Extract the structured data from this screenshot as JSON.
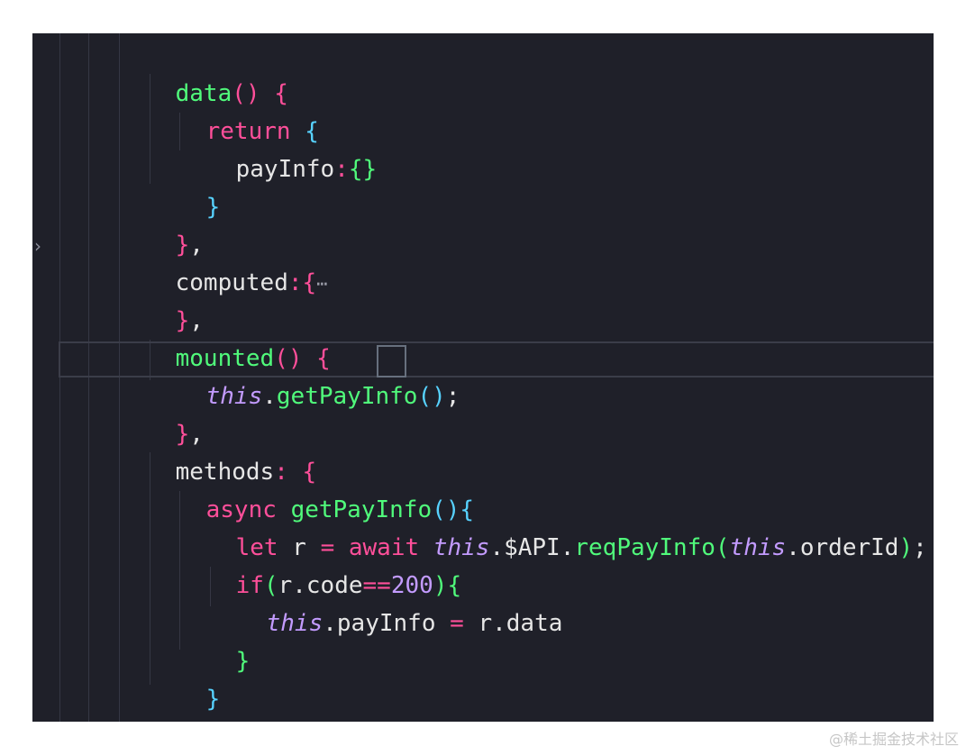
{
  "editor": {
    "fold_marker": "›",
    "collapsed_ellipsis": "⋯",
    "lines": [
      [
        "data",
        "()",
        " {"
      ],
      [
        "return",
        " {"
      ],
      [
        "payInfo",
        ":",
        "{}"
      ],
      [
        "}"
      ],
      [
        "}",
        ","
      ],
      [
        "computed",
        ":",
        "{"
      ],
      [
        "}",
        ","
      ],
      [
        "mounted",
        "()",
        " {"
      ],
      [
        "this",
        ".",
        "getPayInfo",
        "(",
        ")",
        ";"
      ],
      [
        "}",
        ","
      ],
      [
        "methods",
        ":",
        " {"
      ],
      [
        "async",
        " ",
        "getPayInfo",
        "()",
        "{"
      ],
      [
        "let",
        " ",
        "r",
        " ",
        "=",
        " ",
        "await",
        " ",
        "this",
        ".",
        "$API",
        ".",
        "reqPayInfo",
        "(",
        "this",
        ".",
        "orderId",
        ")",
        ";"
      ],
      [
        "if",
        "(",
        "r",
        ".",
        "code",
        "==",
        "200",
        ")",
        "{"
      ],
      [
        "this",
        ".",
        "payInfo",
        " ",
        "=",
        " ",
        "r",
        ".",
        "data"
      ],
      [
        "}"
      ],
      [
        "}"
      ],
      [
        "}",
        ","
      ]
    ]
  },
  "watermark": "@稀土掘金技术社区",
  "colors": {
    "background": "#1f2029",
    "function": "#50fa7b",
    "keyword": "#ff4f9a",
    "brace_cyan": "#57d2ff",
    "this_keyword": "#c39bff",
    "text": "#e6e6e6"
  }
}
